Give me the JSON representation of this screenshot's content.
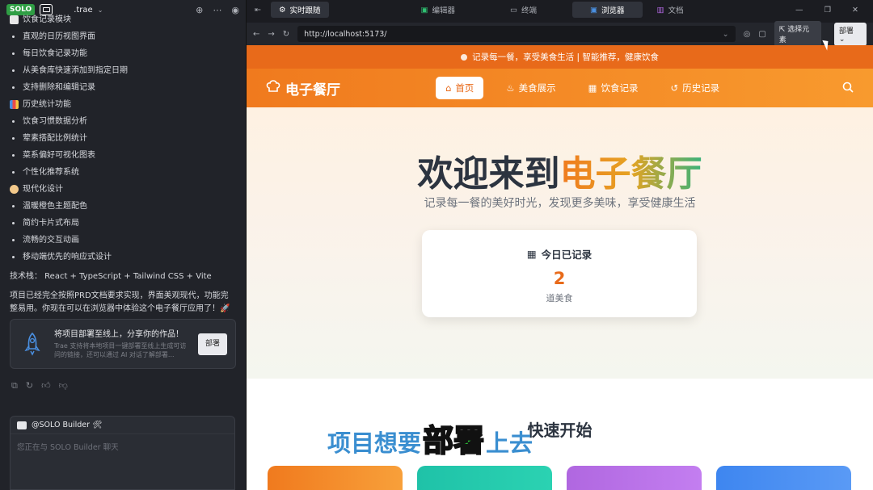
{
  "ide": {
    "solo_badge": "SOLO",
    "workspace": ".trae",
    "sections": [
      {
        "title": "饮食记录模块",
        "items": [
          "直观的日历视图界面",
          "每日饮食记录功能",
          "从美食库快速添加到指定日期",
          "支持删除和编辑记录"
        ]
      },
      {
        "title": "历史统计功能",
        "items": [
          "饮食习惯数据分析",
          "荤素搭配比例统计",
          "菜系偏好可视化图表",
          "个性化推荐系统"
        ]
      },
      {
        "title": "现代化设计",
        "items": [
          "温暖橙色主题配色",
          "简约卡片式布局",
          "流畅的交互动画",
          "移动端优先的响应式设计"
        ]
      }
    ],
    "tech_stack": "技术栈： React + TypeScript + Tailwind CSS + Vite",
    "summary": "项目已经完全按照PRD文档要求实现，界面美观现代，功能完整易用。你现在可以在浏览器中体验这个电子餐厅应用了！🚀",
    "deploy_card": {
      "title": "将项目部署至线上，分享你的作品！",
      "sub": "Trae 支持将本地项目一键部署至线上生成可访问的链接，还可以通过 AI 对话了解部署...",
      "button": "部署"
    },
    "chat": {
      "agent": "@SOLO Builder 🛠",
      "placeholder": "您正在与 SOLO Builder 聊天"
    }
  },
  "tabs": {
    "realtime": "实时跟随",
    "editor": "编辑器",
    "terminal": "终端",
    "browser": "浏览器",
    "docs": "文档"
  },
  "browser": {
    "url": "http://localhost:5173/",
    "select_element": "选择元素",
    "deploy": "部署"
  },
  "site": {
    "notice": "记录每一餐，享受美食生活 | 智能推荐，健康饮食",
    "brand": "电子餐厅",
    "nav": [
      {
        "label": "首页",
        "icon": "home-icon"
      },
      {
        "label": "美食展示",
        "icon": "chef-hat-icon"
      },
      {
        "label": "饮食记录",
        "icon": "calendar-icon"
      },
      {
        "label": "历史记录",
        "icon": "history-icon"
      }
    ],
    "hero_title_plain": "欢迎来到",
    "hero_title_accent": "电子餐厅",
    "hero_sub": "记录每一餐的美好时光，发现更多美味，享受健康生活",
    "today_label": "今日已记录",
    "today_count": "2",
    "today_unit": "道美食",
    "quick_start": "快速开始",
    "quick_colors": [
      "#f07a1e",
      "#1fc2a8",
      "#b067e0",
      "#3e86f0"
    ]
  },
  "caption": {
    "pre": "项目想要",
    "highlight": "部署",
    "post": "上去"
  }
}
